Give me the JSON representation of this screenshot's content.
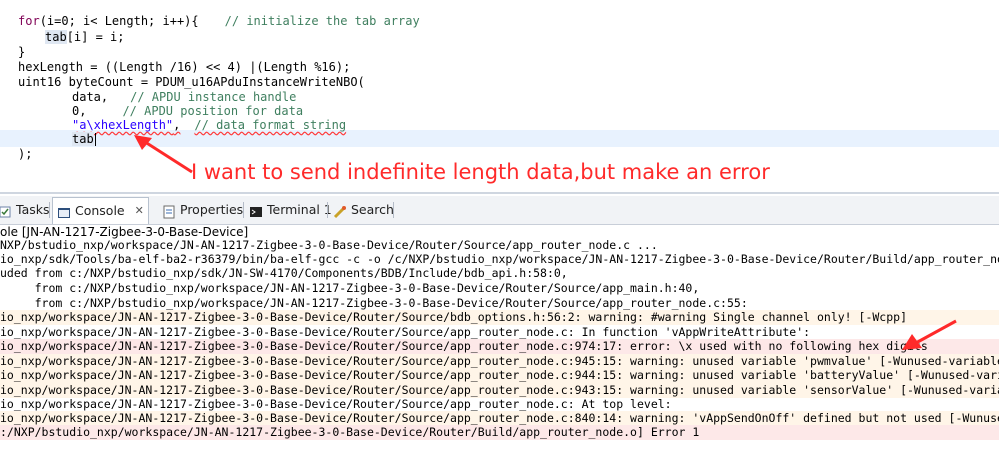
{
  "editor": {
    "line1_kw": "for",
    "line1_code": "(i=0; i< Length; i++){",
    "line1_comment": "// initialize the tab array",
    "line2_hl": "tab",
    "line2_rest": "[i] = i;",
    "line3": "}",
    "line4": "hexLength = ((Length /16) << 4) |(Length %16);",
    "line5": "uint16 byteCount = PDUM_u16APduInstanceWriteNBO(",
    "line6_code": "data,",
    "line6_comment": "// APDU instance handle",
    "line7_code": "0,",
    "line7_comment": "// APDU position for data",
    "line8_string": "\"a\\xhexLength\"",
    "line8_comma": ",",
    "line8_comment": "// data format string",
    "line9": "tab",
    "line10": ");"
  },
  "annotation": {
    "text": "I want to send indefinite length data,but make an error",
    "color": "#ff2a2a"
  },
  "tabs": [
    {
      "label": "Tasks",
      "icon": "tasks-icon"
    },
    {
      "label": "Console",
      "icon": "console-icon",
      "active": true,
      "close": "✕"
    },
    {
      "label": "Properties",
      "icon": "properties-icon"
    },
    {
      "label": "Terminal 1",
      "icon": "terminal-icon"
    },
    {
      "label": "Search",
      "icon": "search-icon"
    }
  ],
  "console": {
    "title": "ole [JN-AN-1217-Zigbee-3-0-Base-Device]",
    "lines": [
      "NXP/bstudio_nxp/workspace/JN-AN-1217-Zigbee-3-0-Base-Device/Router/Source/app_router_node.c ...",
      "io_nxp/sdk/Tools/ba-elf-ba2-r36379/bin/ba-elf-gcc -c -o /c/NXP/bstudio_nxp/workspace/JN-AN-1217-Zigbee-3-0-Base-Device/Router/Build/app_router_node.",
      "uded from c:/NXP/bstudio_nxp/sdk/JN-SW-4170/Components/BDB/Include/bdb_api.h:58:0,",
      "     from c:/NXP/bstudio_nxp/workspace/JN-AN-1217-Zigbee-3-0-Base-Device/Router/Source/app_main.h:40,",
      "     from c:/NXP/bstudio_nxp/workspace/JN-AN-1217-Zigbee-3-0-Base-Device/Router/Source/app_router_node.c:55:",
      "io_nxp/workspace/JN-AN-1217-Zigbee-3-0-Base-Device/Router/Source/bdb_options.h:56:2: warning: #warning Single channel only! [-Wcpp]",
      "io_nxp/workspace/JN-AN-1217-Zigbee-3-0-Base-Device/Router/Source/app_router_node.c: In function 'vAppWriteAttribute':",
      "io_nxp/workspace/JN-AN-1217-Zigbee-3-0-Base-Device/Router/Source/app_router_node.c:974:17: error: \\x used with no following hex digits",
      "io_nxp/workspace/JN-AN-1217-Zigbee-3-0-Base-Device/Router/Source/app_router_node.c:945:15: warning: unused variable 'pwmvalue' [-Wunused-variable]",
      "io_nxp/workspace/JN-AN-1217-Zigbee-3-0-Base-Device/Router/Source/app_router_node.c:944:15: warning: unused variable 'batteryValue' [-Wunused-variabl",
      "io_nxp/workspace/JN-AN-1217-Zigbee-3-0-Base-Device/Router/Source/app_router_node.c:943:15: warning: unused variable 'sensorValue' [-Wunused-variable",
      "io_nxp/workspace/JN-AN-1217-Zigbee-3-0-Base-Device/Router/Source/app_router_node.c: At top level:",
      "io_nxp/workspace/JN-AN-1217-Zigbee-3-0-Base-Device/Router/Source/app_router_node.c:840:14: warning: 'vAppSendOnOff' defined but not used [-Wunused-f",
      ":/NXP/bstudio_nxp/workspace/JN-AN-1217-Zigbee-3-0-Base-Device/Router/Build/app_router_node.o] Error 1"
    ]
  }
}
